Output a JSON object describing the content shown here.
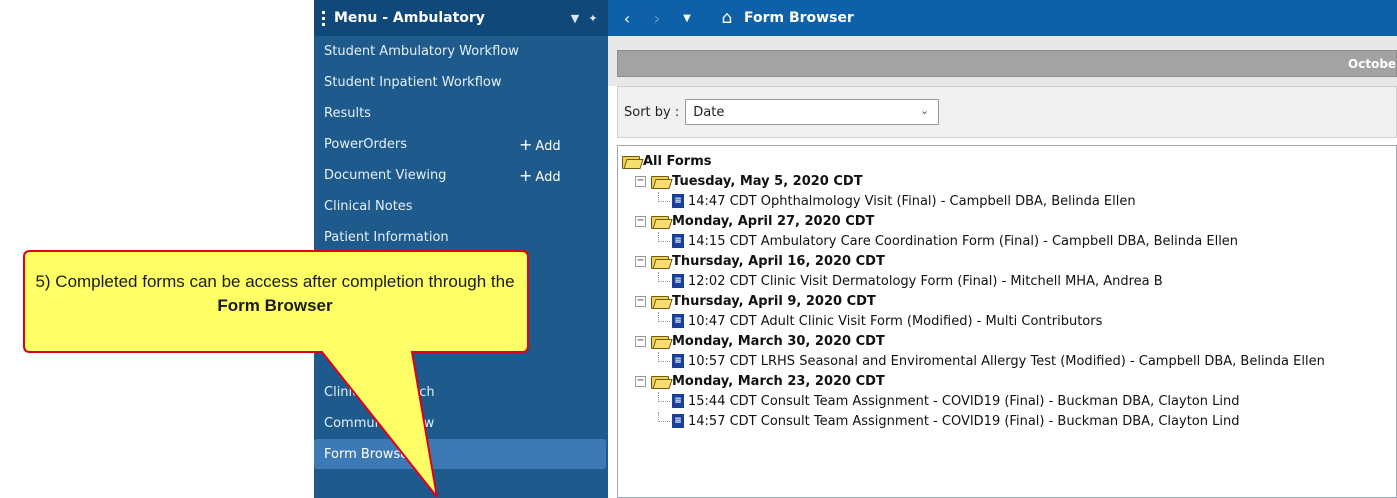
{
  "menu": {
    "title": "Menu - Ambulatory",
    "header_icons": [
      "chevron-down-icon",
      "pin-icon"
    ],
    "items": [
      {
        "label": "Student Ambulatory Workflow"
      },
      {
        "label": "Student Inpatient Workflow"
      },
      {
        "label": "Results"
      },
      {
        "label": "PowerOrders",
        "add": "Add"
      },
      {
        "label": "Document Viewing",
        "add": "Add"
      },
      {
        "label": "Clinical Notes"
      },
      {
        "label": "Patient Information"
      },
      {
        "label": ""
      },
      {
        "label": ""
      },
      {
        "label": ""
      },
      {
        "label": ""
      },
      {
        "label": "Clinical Research"
      },
      {
        "label": "Community View"
      },
      {
        "label": "Form Browser",
        "selected": true
      }
    ],
    "colors": {
      "background": "#1e5b8c",
      "header": "#11487a",
      "selected": "#3d79b5"
    }
  },
  "toolbar": {
    "title": "Form Browser",
    "icons": [
      "back-arrow-icon",
      "forward-arrow-icon",
      "dropdown-icon",
      "home-icon"
    ]
  },
  "date_band": "October",
  "sort": {
    "label": "Sort by :",
    "value": "Date"
  },
  "tree": {
    "root": "All Forms",
    "groups": [
      {
        "date": "Tuesday, May 5, 2020 CDT",
        "forms": [
          "14:47 CDT Ophthalmology Visit (Final) - Campbell DBA, Belinda Ellen"
        ]
      },
      {
        "date": "Monday, April 27, 2020 CDT",
        "forms": [
          "14:15 CDT Ambulatory Care Coordination Form (Final) - Campbell DBA, Belinda Ellen"
        ]
      },
      {
        "date": "Thursday, April 16, 2020 CDT",
        "forms": [
          "12:02 CDT Clinic Visit Dermatology Form (Final) - Mitchell MHA, Andrea B"
        ]
      },
      {
        "date": "Thursday, April 9, 2020 CDT",
        "forms": [
          "10:47 CDT Adult Clinic Visit Form (Modified) - Multi Contributors"
        ]
      },
      {
        "date": "Monday, March 30, 2020 CDT",
        "forms": [
          "10:57 CDT LRHS Seasonal and Enviromental Allergy Test (Modified) - Campbell DBA, Belinda Ellen"
        ]
      },
      {
        "date": "Monday, March 23, 2020 CDT",
        "forms": [
          "15:44 CDT Consult Team Assignment - COVID19 (Final) - Buckman DBA, Clayton Lind",
          "14:57 CDT Consult Team Assignment - COVID19 (Final) - Buckman DBA, Clayton Lind"
        ]
      }
    ]
  },
  "callout": {
    "text_prefix": "5) Completed forms can be access after completion through the ",
    "text_bold": "Form Browser",
    "colors": {
      "fill": "#ffff66",
      "stroke": "#e0001b"
    }
  }
}
